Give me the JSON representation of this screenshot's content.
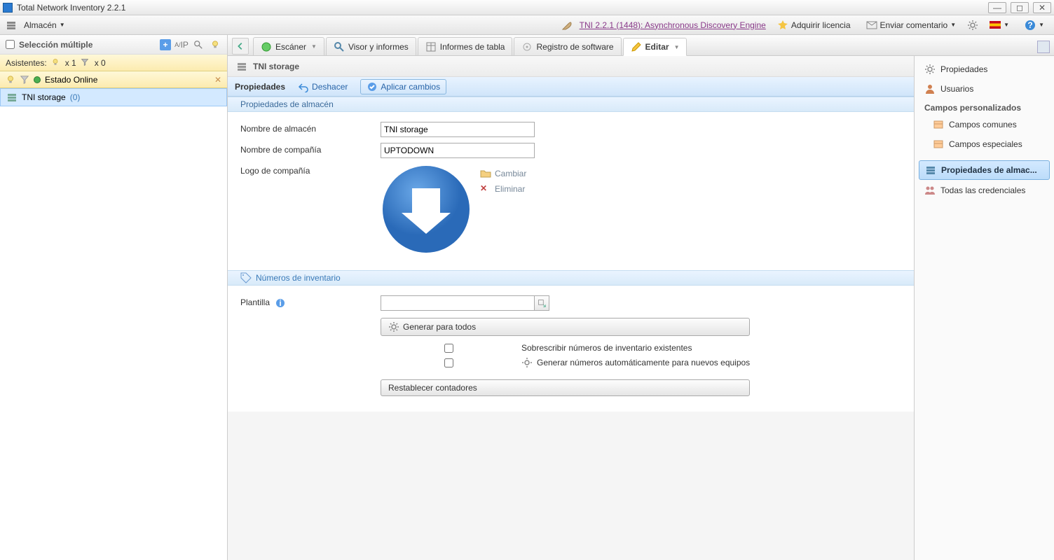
{
  "title": "Total Network Inventory 2.2.1",
  "menubar": {
    "almacen": "Almacén",
    "link": "TNI 2.2.1 (1448): Asynchronous Discovery Engine",
    "license": "Adquirir licencia",
    "feedback": "Enviar comentario"
  },
  "sidebar_left": {
    "multisel": "Selección múltiple",
    "asist_label": "Asistentes:",
    "bulb_count": "x 1",
    "funnel_count": "x 0",
    "status": "Estado Online",
    "tree": {
      "name": "TNI storage",
      "count": "(0)"
    }
  },
  "tabs": {
    "scanner": "Escáner",
    "viewer": "Visor y informes",
    "table": "Informes de tabla",
    "software": "Registro de software",
    "edit": "Editar"
  },
  "panel": {
    "title": "TNI storage",
    "sub_active": "Propiedades",
    "undo": "Deshacer",
    "apply": "Aplicar cambios"
  },
  "sections": {
    "storage_props": "Propiedades de almacén",
    "inventory_nums": "Números de inventario"
  },
  "form": {
    "storage_name_label": "Nombre de almacén",
    "storage_name_value": "TNI storage",
    "company_name_label": "Nombre de compañía",
    "company_name_value": "UPTODOWN",
    "company_logo_label": "Logo de compañía",
    "change": "Cambiar",
    "delete": "Eliminar",
    "template_label": "Plantilla",
    "template_value": "",
    "generate_all": "Generar para todos",
    "overwrite": "Sobrescribir números de inventario existentes",
    "autogen": "Generar números automáticamente para nuevos equipos",
    "reset": "Restablecer contadores"
  },
  "sidebar_right": {
    "properties": "Propiedades",
    "users": "Usuarios",
    "custom_header": "Campos personalizados",
    "common_fields": "Campos comunes",
    "special_fields": "Campos especiales",
    "storage_props": "Propiedades de almac...",
    "credentials": "Todas las credenciales"
  }
}
